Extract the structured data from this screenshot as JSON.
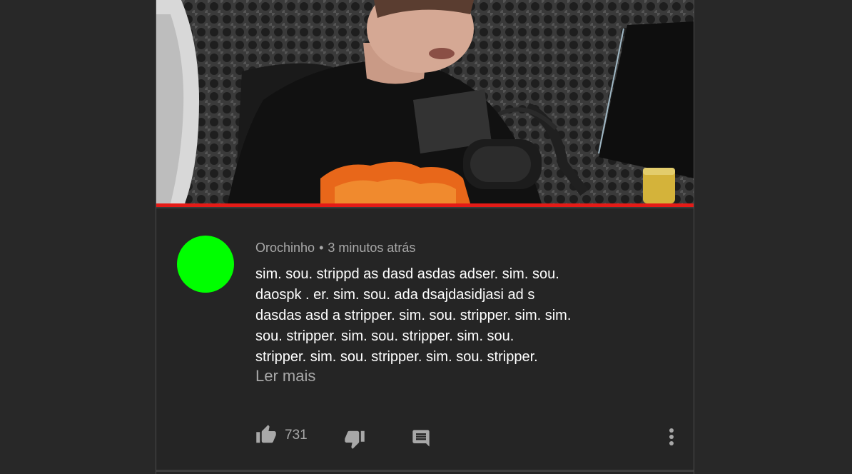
{
  "video": {
    "progress_fraction": 1.0
  },
  "comment": {
    "avatar_color": "#00ff00",
    "author": "Orochinho",
    "separator": "•",
    "time": "3 minutos atrás",
    "lines": [
      "sim. sou. strippd as dasd asdas adser. sim. sou.",
      "daospk . er. sim. sou. ada dsajdasidjasi ad s",
      "dasdas asd a stripper. sim. sou. stripper. sim. sim.",
      "sou. stripper. sim. sou. stripper. sim. sou.",
      "stripper. sim. sou. stripper. sim. sou. stripper."
    ],
    "read_more": "Ler mais"
  },
  "actions": {
    "like_icon": "thumb-up-icon",
    "like_count": "731",
    "dislike_icon": "thumb-down-icon",
    "reply_icon": "comment-icon",
    "more_icon": "more-vertical-icon"
  },
  "colors": {
    "background": "#282828",
    "card": "#252525",
    "progress": "#e41b17",
    "text_primary": "#ffffff",
    "text_secondary": "#a8a8a8"
  }
}
